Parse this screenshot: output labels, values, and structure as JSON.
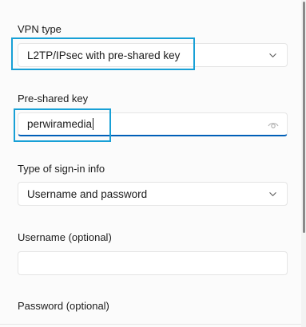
{
  "vpn_type": {
    "label": "VPN type",
    "selected": "L2TP/IPsec with pre-shared key"
  },
  "pre_shared_key": {
    "label": "Pre-shared key",
    "value": "perwiramedia"
  },
  "sign_in_type": {
    "label": "Type of sign-in info",
    "selected": "Username and password"
  },
  "username": {
    "label": "Username (optional)",
    "value": ""
  },
  "password": {
    "label": "Password (optional)"
  },
  "colors": {
    "highlight": "#18a0d6",
    "accent": "#005fb8",
    "field_border": "#e5e5e5",
    "background": "#fbfbfb"
  },
  "icons": {
    "dropdown": "chevron-down-icon",
    "reveal": "eye-icon"
  }
}
